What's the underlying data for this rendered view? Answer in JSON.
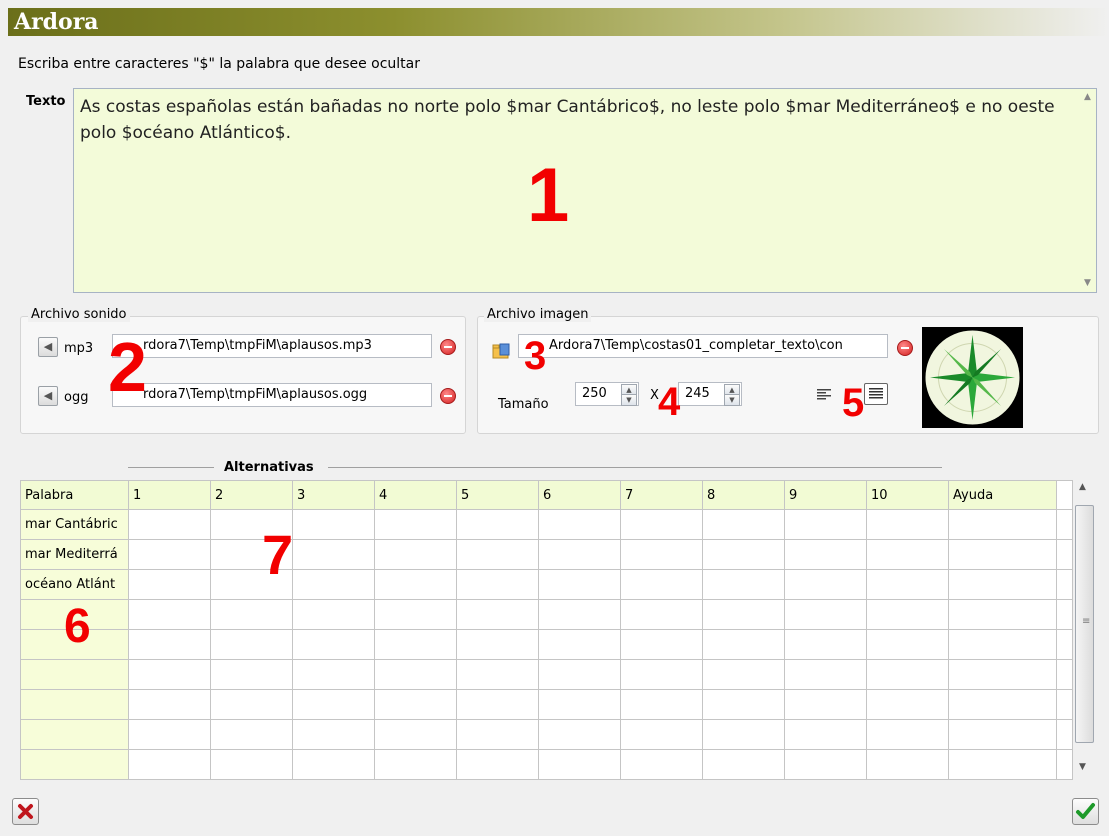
{
  "title": "Ardora",
  "instructions": "Escriba entre caracteres \"$\" la palabra que desee ocultar",
  "texto": {
    "label": "Texto",
    "value": "As costas españolas están bañadas no norte polo $mar Cantábrico$, no leste polo $mar Mediterráneo$ e no oeste polo $océano Atlántico$."
  },
  "sonido": {
    "legend": "Archivo sonido",
    "mp3_label": "mp3",
    "mp3_path": "rdora7\\Temp\\tmpFiM\\aplausos.mp3",
    "ogg_label": "ogg",
    "ogg_path": "rdora7\\Temp\\tmpFiM\\aplausos.ogg"
  },
  "imagen": {
    "legend": "Archivo imagen",
    "path": "Ardora7\\Temp\\costas01_completar_texto\\con",
    "size_label": "Tamaño",
    "width": "250",
    "x": "X",
    "height": "245"
  },
  "alternativas": {
    "title": "Alternativas",
    "headers": [
      "Palabra",
      "1",
      "2",
      "3",
      "4",
      "5",
      "6",
      "7",
      "8",
      "9",
      "10",
      "Ayuda"
    ],
    "words": [
      "mar Cantábric",
      "mar Mediterrá",
      "océano Atlánt",
      "",
      "",
      "",
      "",
      "",
      ""
    ]
  },
  "markers": [
    "1",
    "2",
    "3",
    "4",
    "5",
    "6",
    "7"
  ],
  "icons": {
    "speaker": "speaker-icon",
    "remove": "remove-icon",
    "folder": "folder-icon",
    "align_left": "align-left-icon",
    "align_justify": "align-justify-icon",
    "cancel": "cancel-x-icon",
    "ok": "checkmark-icon"
  },
  "colors": {
    "text_bg": "#f3fbd9",
    "marker": "#f20000"
  }
}
